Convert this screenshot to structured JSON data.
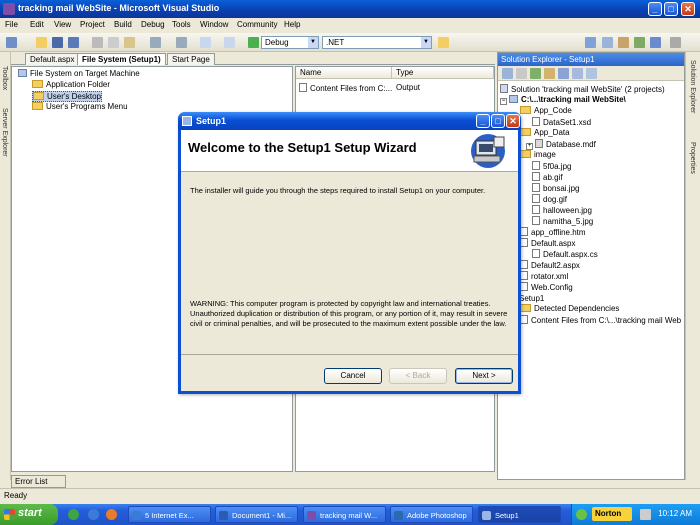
{
  "window": {
    "title": "tracking mail WebSite - Microsoft Visual Studio",
    "btn_min": "_",
    "btn_max": "□",
    "btn_close": "✕"
  },
  "menu": [
    "File",
    "Edit",
    "View",
    "Project",
    "Build",
    "Debug",
    "Tools",
    "Window",
    "Community",
    "Help"
  ],
  "toolbar": {
    "config_value": "Debug",
    "platform_value": ".NET"
  },
  "left_strip": {
    "toolbox_label": "Toolbox",
    "server_explorer_label": "Server Explorer"
  },
  "tabs": [
    "Default.aspx",
    "File System (Setup1)",
    "Start Page"
  ],
  "fs_tree": {
    "root": "File System on Target Machine",
    "items": [
      "Application Folder",
      "User's Desktop",
      "User's Programs Menu"
    ]
  },
  "list": {
    "col_name": "Name",
    "col_type": "Type",
    "row_name": "Content Files from C:...",
    "row_type": "Output"
  },
  "solution_explorer": {
    "title": "Solution Explorer - Setup1",
    "items": [
      "Solution 'tracking mail WebSite' (2 projects)",
      "C:\\...\\tracking mail WebSite\\",
      "App_Code",
      "DataSet1.xsd",
      "App_Data",
      "Database.mdf",
      "image",
      "5f0a.jpg",
      "ab.gif",
      "bonsai.jpg",
      "dog.gif",
      "halloween.jpg",
      "namitha_5.jpg",
      "app_offline.htm",
      "Default.aspx",
      "Default.aspx.cs",
      "Default2.aspx",
      "rotator.xml",
      "Web.Config",
      "Setup1",
      "Detected Dependencies",
      "Content Files from C:\\...\\tracking mail Web"
    ]
  },
  "right_strip": {
    "solution_explorer_label": "Solution Explorer",
    "properties_label": "Properties"
  },
  "error_list_label": "Error List",
  "status": "Ready",
  "dialog": {
    "title": "Setup1",
    "heading": "Welcome to the Setup1 Setup Wizard",
    "intro": "The installer will guide you through the steps required to install Setup1 on your computer.",
    "warning": "WARNING: This computer program is protected by copyright law and international treaties. Unauthorized duplication or distribution of this program, or any portion of it, may result in severe civil or criminal penalties, and will be prosecuted to the maximum extent possible under the law.",
    "cancel": "Cancel",
    "back": "< Back",
    "next": "Next >"
  },
  "taskbar": {
    "start": "start",
    "tasks": [
      "5 Internet Ex...",
      "Document1 - Mi...",
      "tracking mail W...",
      "Adobe Photoshop",
      "Setup1"
    ],
    "norton": "Norton",
    "clock": "10:12 AM"
  }
}
